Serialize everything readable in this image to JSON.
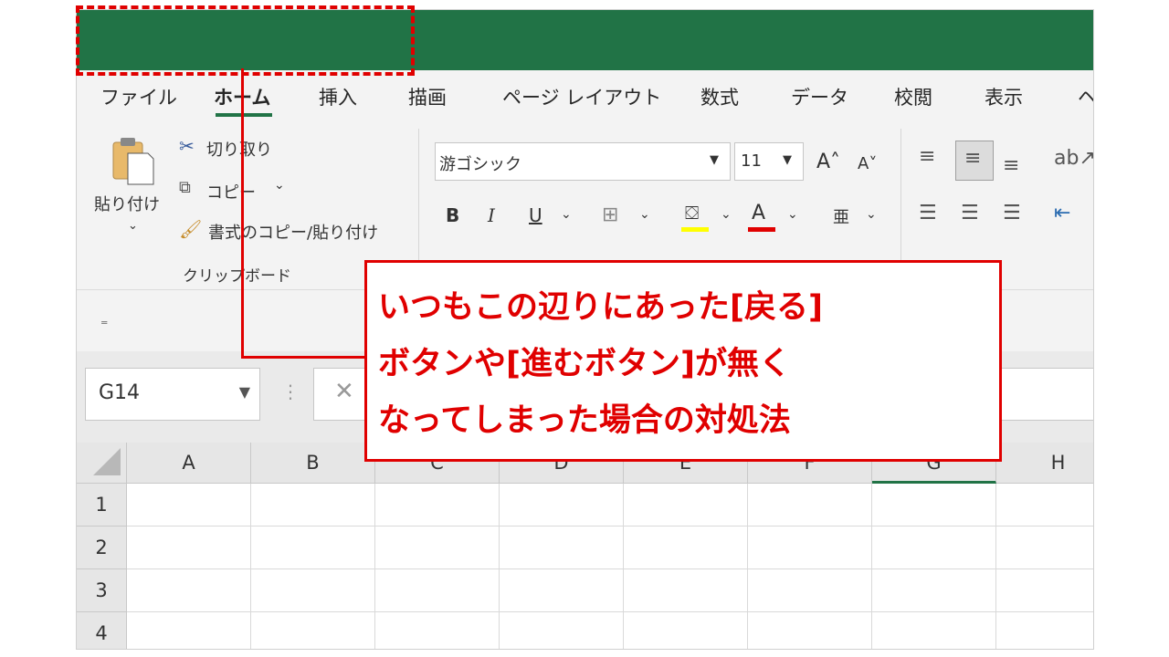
{
  "colors": {
    "title_bar": "#217346",
    "accent_red": "#e00000"
  },
  "tabs": [
    {
      "label": "ファイル"
    },
    {
      "label": "ホーム"
    },
    {
      "label": "挿入"
    },
    {
      "label": "描画"
    },
    {
      "label": "ページ レイアウト"
    },
    {
      "label": "数式"
    },
    {
      "label": "データ"
    },
    {
      "label": "校閲"
    },
    {
      "label": "表示"
    },
    {
      "label": "ヘ"
    }
  ],
  "clipboard": {
    "paste_label": "貼り付け",
    "cut_label": "切り取り",
    "copy_label": "コピー",
    "format_painter_label": "書式のコピー/貼り付け",
    "group_label": "クリップボード"
  },
  "font": {
    "name": "游ゴシック",
    "size": "11",
    "bold": "B",
    "italic": "I",
    "underline": "U",
    "font_color_letter": "A"
  },
  "name_box": {
    "value": "G14"
  },
  "formula_cancel_icon": "close-icon",
  "columns": [
    "A",
    "B",
    "C",
    "D",
    "E",
    "F",
    "G",
    "H"
  ],
  "rows": [
    "1",
    "2",
    "3",
    "4"
  ],
  "callout": {
    "line1": "いつもこの辺りにあった[戻る]",
    "line2": "ボタンや[進むボタン]が無く",
    "line3": "なってしまった場合の対処法"
  }
}
